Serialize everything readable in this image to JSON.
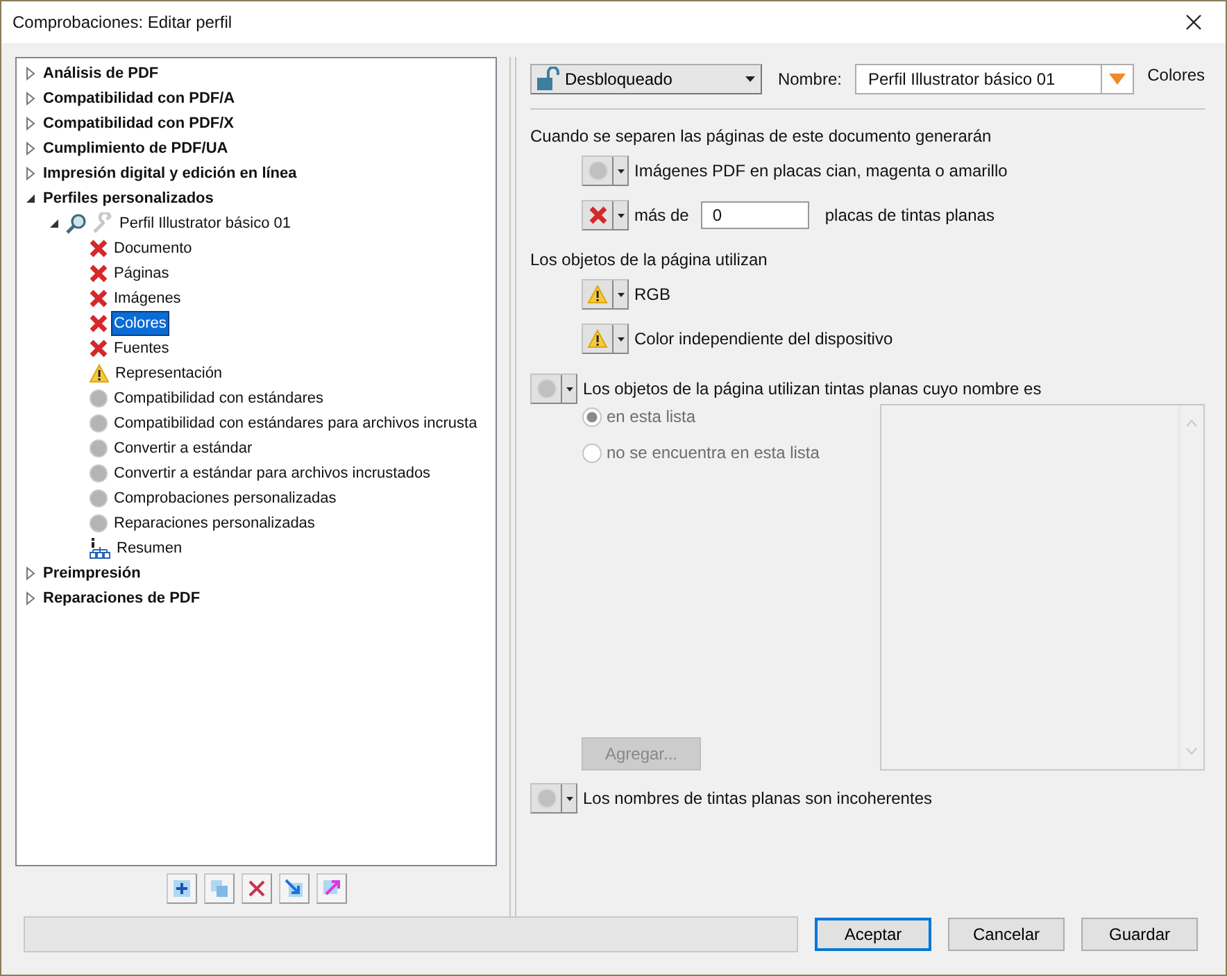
{
  "window": {
    "title": "Comprobaciones: Editar perfil"
  },
  "tree": [
    {
      "label": "Análisis de PDF",
      "expanded": false,
      "selected": false
    },
    {
      "label": "Compatibilidad con PDF/A",
      "expanded": false,
      "selected": false
    },
    {
      "label": "Compatibilidad con PDF/X",
      "expanded": false,
      "selected": false
    },
    {
      "label": "Cumplimiento de PDF/UA",
      "expanded": false,
      "selected": false
    },
    {
      "label": "Impresión digital y edición en línea",
      "expanded": false,
      "selected": false
    },
    {
      "label": "Perfiles personalizados",
      "expanded": true,
      "selected": false,
      "children": [
        {
          "label": "Perfil Illustrator básico 01",
          "kind": "profile",
          "expanded": true,
          "selected": false,
          "children": [
            {
              "label": "Documento",
              "kind": "error",
              "selected": false
            },
            {
              "label": "Páginas",
              "kind": "error",
              "selected": false
            },
            {
              "label": "Imágenes",
              "kind": "error",
              "selected": false
            },
            {
              "label": "Colores",
              "kind": "error",
              "selected": true
            },
            {
              "label": "Fuentes",
              "kind": "error",
              "selected": false
            },
            {
              "label": "Representación",
              "kind": "warning",
              "selected": false
            },
            {
              "label": "Compatibilidad con estándares",
              "kind": "none",
              "selected": false
            },
            {
              "label": "Compatibilidad con estándares para archivos incrusta",
              "kind": "none",
              "selected": false
            },
            {
              "label": "Convertir a estándar",
              "kind": "none",
              "selected": false
            },
            {
              "label": "Convertir a estándar para archivos incrustados",
              "kind": "none",
              "selected": false
            },
            {
              "label": "Comprobaciones personalizadas",
              "kind": "none",
              "selected": false
            },
            {
              "label": "Reparaciones personalizadas",
              "kind": "none",
              "selected": false
            },
            {
              "label": "Resumen",
              "kind": "summary",
              "selected": false
            }
          ]
        }
      ]
    },
    {
      "label": "Preimpresión",
      "expanded": false,
      "selected": false
    },
    {
      "label": "Reparaciones de PDF",
      "expanded": false,
      "selected": false
    }
  ],
  "lock_dropdown": {
    "label": "Desbloqueado"
  },
  "name_label": "Nombre:",
  "name_field": {
    "value": "Perfil Illustrator básico 01"
  },
  "section_title": "Colores",
  "sections": [
    {
      "heading": "Cuando se separen las páginas de este documento generarán",
      "rules": [
        {
          "kind": "none",
          "text": "Imágenes PDF en placas cian, magenta o amarillo"
        },
        {
          "kind": "error",
          "text": "más de",
          "value": "0",
          "suffix": "placas de tintas planas"
        }
      ]
    },
    {
      "heading": "Los objetos de la página utilizan",
      "rules": [
        {
          "kind": "warning",
          "text": "RGB"
        },
        {
          "kind": "warning",
          "text": "Color independiente del dispositivo"
        }
      ]
    }
  ],
  "spot_rule": {
    "kind": "none",
    "text": "Los objetos de la página utilizan tintas planas cuyo nombre es",
    "options": [
      {
        "label": "en esta lista",
        "selected": true,
        "disabled": true
      },
      {
        "label": "no se encuentra en esta lista",
        "selected": false,
        "disabled": true
      }
    ],
    "add_button": {
      "label": "Agregar...",
      "disabled": true
    }
  },
  "last_rule": {
    "kind": "none",
    "text": "Los nombres de tintas planas son incoherentes"
  },
  "buttons": [
    {
      "label": "Aceptar",
      "default": true
    },
    {
      "label": "Cancelar",
      "default": false
    },
    {
      "label": "Guardar",
      "default": false
    }
  ]
}
